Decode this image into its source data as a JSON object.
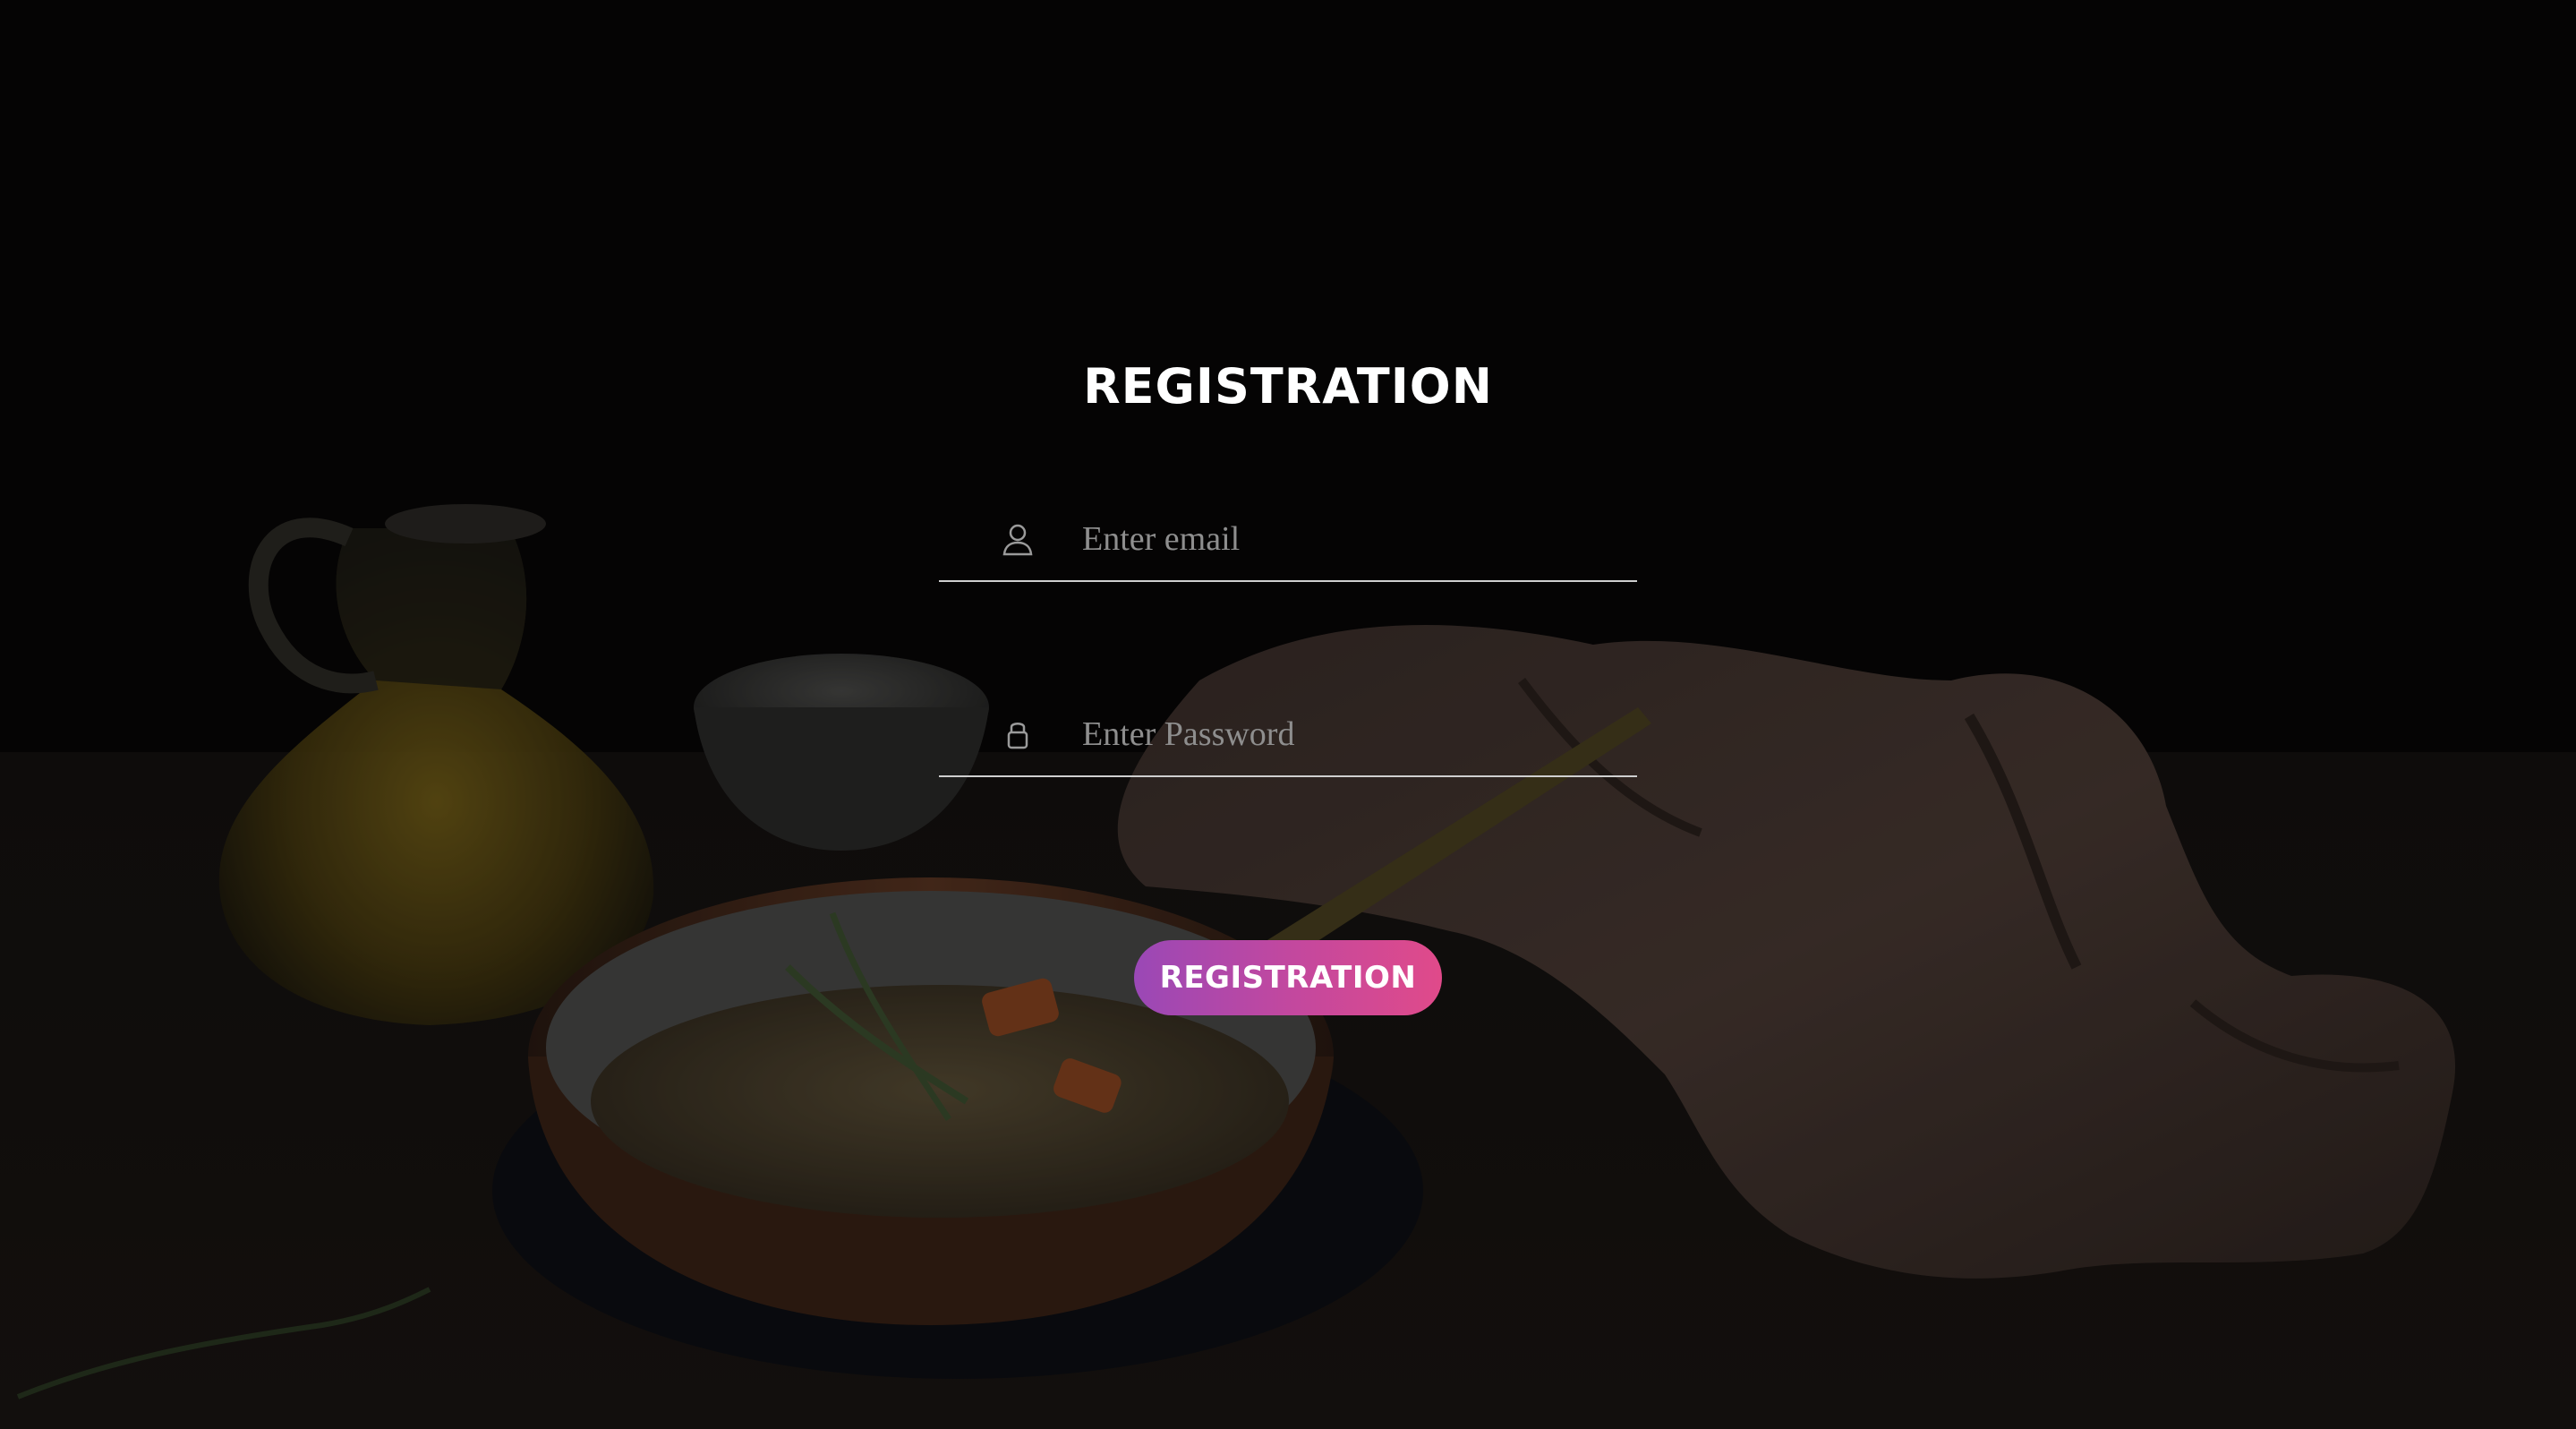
{
  "page": {
    "title": "REGISTRATION"
  },
  "form": {
    "email": {
      "icon": "user-icon",
      "placeholder": "Enter email",
      "value": ""
    },
    "password": {
      "icon": "lock-icon",
      "placeholder": "Enter Password",
      "value": ""
    },
    "submit_label": "REGISTRATION"
  },
  "colors": {
    "background": "#050404",
    "title_text": "#ffffff",
    "input_underline": "#cfcfcf",
    "placeholder": "#8e8e8e",
    "button_gradient_start": "#9a48b6",
    "button_gradient_end": "#e04a8a"
  },
  "background_image": {
    "subject": "dark food photograph: lentil stew in a copper pan, olive oil carafe, small bowl, linen napkin, rosemary sprig"
  }
}
